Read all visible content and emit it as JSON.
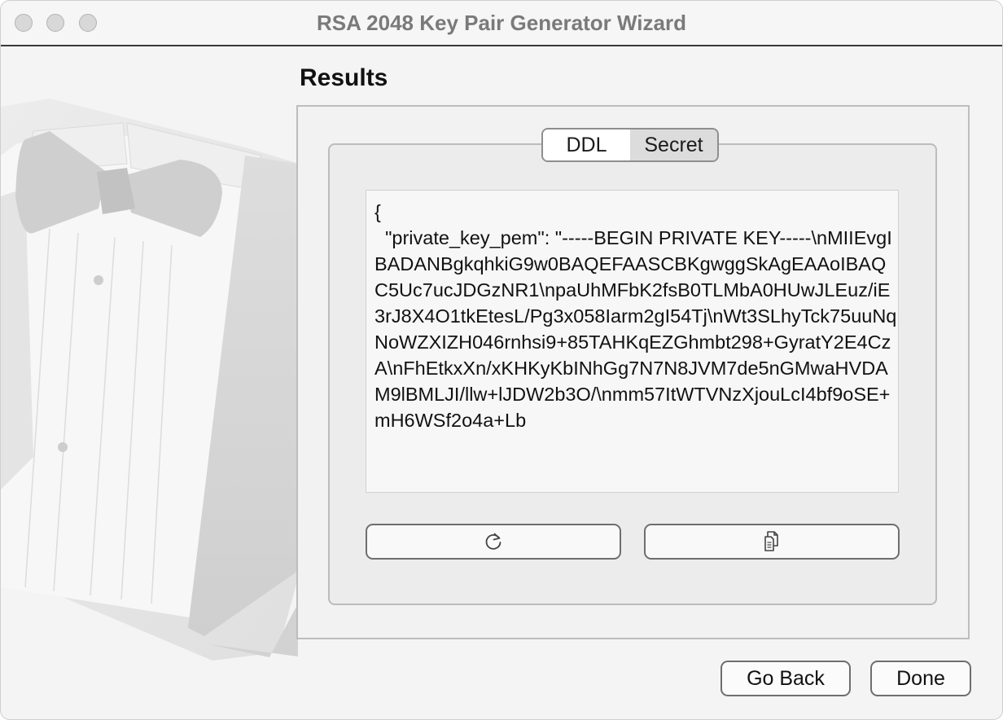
{
  "window": {
    "title": "RSA 2048 Key Pair Generator Wizard"
  },
  "page": {
    "heading": "Results"
  },
  "tabs": [
    {
      "label": "DDL",
      "selected": true
    },
    {
      "label": "Secret",
      "selected": false
    }
  ],
  "output": {
    "text": "{\n  \"private_key_pem\": \"-----BEGIN PRIVATE KEY-----\\nMIIEvgIBADANBgkqhkiG9w0BAQEFAASCBKgwggSkAgEAAoIBAQC5Uc7ucJDGzNR1\\npaUhMFbK2fsB0TLMbA0HUwJLEuz/iE3rJ8X4O1tkEtesL/Pg3x058Iarm2gI54Tj\\nWt3SLhyTck75uuNqNoWZXIZH046rnhsi9+85TAHKqEZGhmbt298+GyratY2E4CzA\\nFhEtkxXn/xKHKyKbINhGg7N7N8JVM7de5nGMwaHVDAM9lBMLJI/llw+lJDW2b3O/\\nmm57ItWTVNzXjouLcI4bf9oSE+mH6WSf2o4a+Lb"
  },
  "buttons": {
    "refresh_icon": "refresh-icon",
    "copy_icon": "copy-icon",
    "go_back": "Go Back",
    "done": "Done"
  }
}
